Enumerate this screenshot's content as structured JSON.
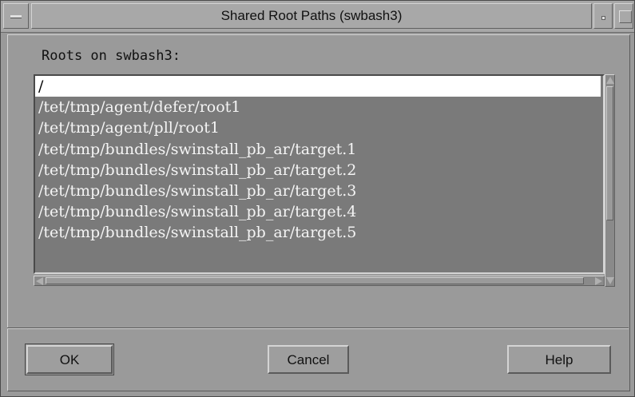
{
  "window": {
    "title": "Shared Root Paths (swbash3)"
  },
  "roots_label": "Roots on swbash3:",
  "roots": [
    "/",
    "/tet/tmp/agent/defer/root1",
    "/tet/tmp/agent/pll/root1",
    "/tet/tmp/bundles/swinstall_pb_ar/target.1",
    "/tet/tmp/bundles/swinstall_pb_ar/target.2",
    "/tet/tmp/bundles/swinstall_pb_ar/target.3",
    "/tet/tmp/bundles/swinstall_pb_ar/target.4",
    "/tet/tmp/bundles/swinstall_pb_ar/target.5"
  ],
  "selected_index": 0,
  "buttons": {
    "ok": "OK",
    "cancel": "Cancel",
    "help": "Help"
  },
  "colors": {
    "background": "#9a9a9a",
    "list_background": "#7a7a7a",
    "selection": "#ffffff"
  }
}
